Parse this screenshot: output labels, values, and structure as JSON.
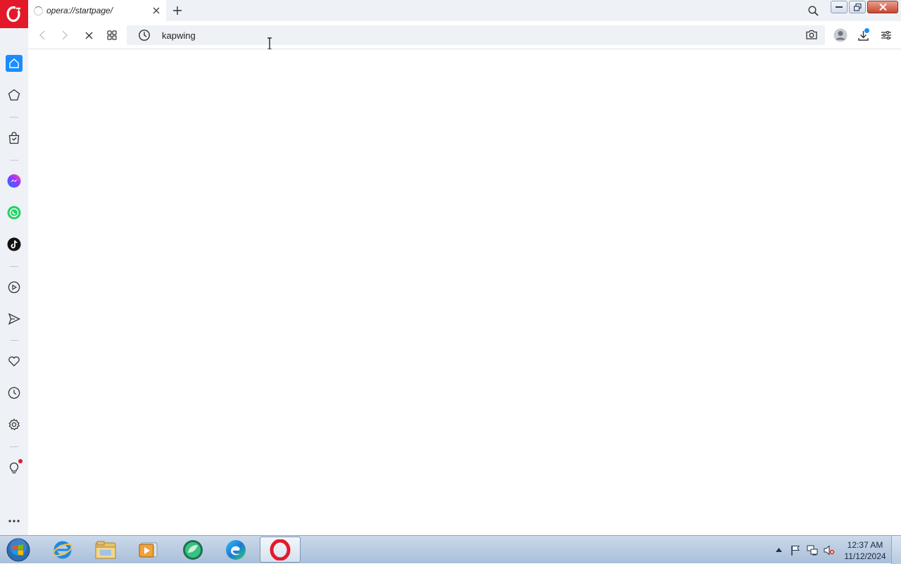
{
  "browser": {
    "tab": {
      "title": "opera://startpage/"
    },
    "address_bar": {
      "value": "kapwing"
    }
  },
  "sidebar": {
    "items": [
      "home-icon",
      "speed-dial-icon",
      "shopping-icon",
      "messenger-icon",
      "whatsapp-icon",
      "tiktok-icon",
      "player-icon",
      "send-icon",
      "heart-icon",
      "history-icon",
      "settings-icon",
      "tips-icon",
      "more-icon"
    ]
  },
  "taskbar": {
    "apps": [
      "internet-explorer-icon",
      "file-explorer-icon",
      "media-player-icon",
      "app-icon",
      "edge-icon",
      "opera-icon"
    ],
    "clock": {
      "time": "12:37 AM",
      "date": "11/12/2024"
    }
  },
  "colors": {
    "opera_red": "#e3192a",
    "sidebar_bg": "#eef1f6",
    "accent_blue": "#1a8cff",
    "whatsapp_green": "#25d366"
  }
}
